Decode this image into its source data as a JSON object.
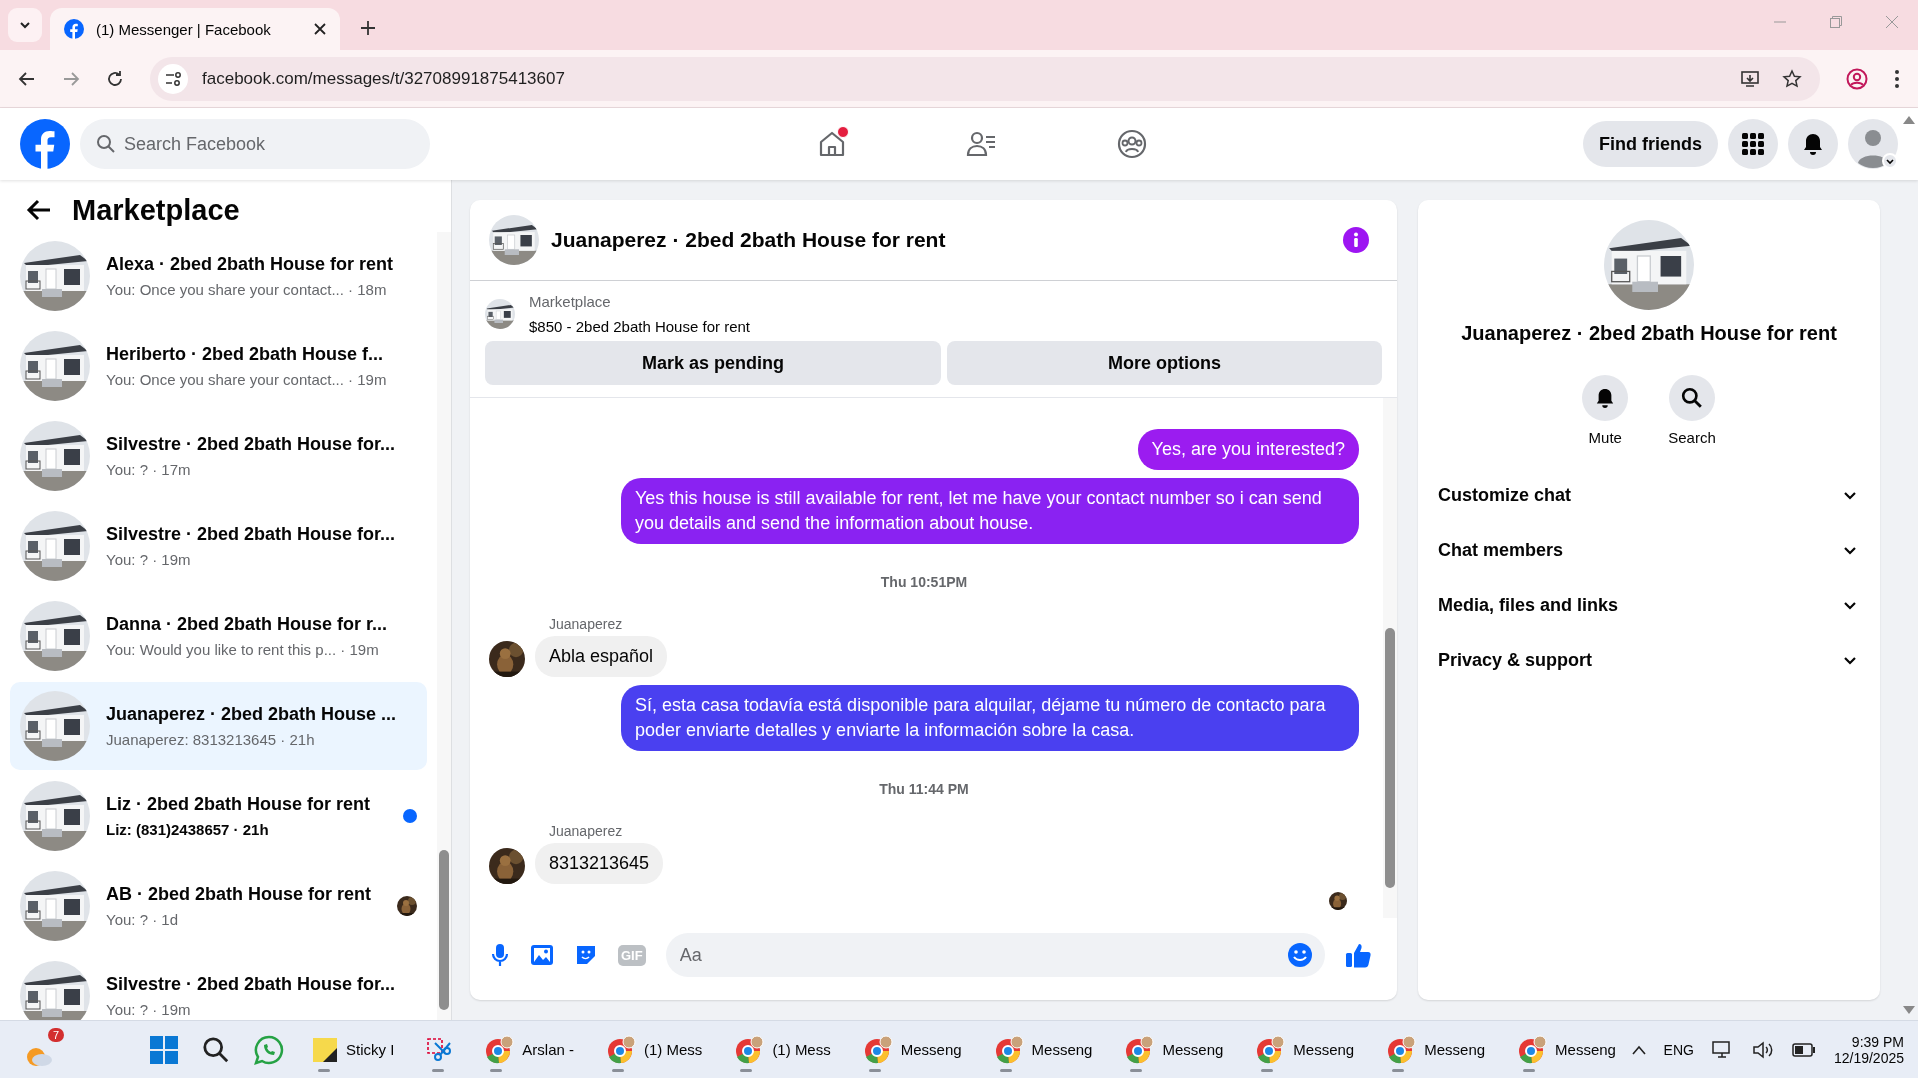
{
  "browser": {
    "tabs": [
      {
        "title": "(1) Messenger | Facebook",
        "selected": true
      }
    ],
    "url": "facebook.com/messages/t/32708991875413607"
  },
  "header": {
    "search_placeholder": "Search Facebook",
    "nav": [
      {
        "kind": "home",
        "selected": false,
        "notification": true
      },
      {
        "kind": "friends",
        "selected": false,
        "notification": false
      },
      {
        "kind": "groups",
        "selected": false,
        "notification": false
      }
    ],
    "find_friends": "Find friends"
  },
  "sidebar": {
    "title": "Marketplace",
    "conversations": [
      {
        "name": "Alexa · 2bed 2bath House for rent",
        "meta": "You: Once you share your contact... · 18m",
        "selected": false,
        "unread": false,
        "unread_dot": false,
        "seen_avatar": false
      },
      {
        "name": "Heriberto · 2bed 2bath House f...",
        "meta": "You: Once you share your contact... · 19m",
        "selected": false,
        "unread": false,
        "unread_dot": false,
        "seen_avatar": false
      },
      {
        "name": "Silvestre · 2bed 2bath House for...",
        "meta": "You: ? · 17m",
        "selected": false,
        "unread": false,
        "unread_dot": false,
        "seen_avatar": false
      },
      {
        "name": "Silvestre · 2bed 2bath House for...",
        "meta": "You: ? · 19m",
        "selected": false,
        "unread": false,
        "unread_dot": false,
        "seen_avatar": false
      },
      {
        "name": "Danna · 2bed 2bath House for r...",
        "meta": "You: Would you like to rent this p... · 19m",
        "selected": false,
        "unread": false,
        "unread_dot": false,
        "seen_avatar": false
      },
      {
        "name": "Juanaperez · 2bed 2bath House ...",
        "meta": "Juanaperez: 8313213645 · 21h",
        "selected": true,
        "unread": false,
        "unread_dot": false,
        "seen_avatar": false
      },
      {
        "name": "Liz · 2bed 2bath House for rent",
        "meta": "Liz: (831)2438657 · 21h",
        "selected": false,
        "unread": true,
        "unread_dot": true,
        "seen_avatar": false
      },
      {
        "name": "AB · 2bed 2bath House for rent",
        "meta": "You: ? · 1d",
        "selected": false,
        "unread": false,
        "unread_dot": false,
        "seen_avatar": true
      },
      {
        "name": "Silvestre · 2bed 2bath House for...",
        "meta": "You: ? · 19m",
        "selected": false,
        "unread": false,
        "unread_dot": false,
        "seen_avatar": false
      }
    ]
  },
  "chat": {
    "title": "Juanaperez · 2bed 2bath House for rent",
    "listing_label": "Marketplace",
    "listing": "$850 - 2bed 2bath House for rent",
    "buttons": [
      "Mark as pending",
      "More options"
    ],
    "messages": [
      {
        "kind": "out",
        "text": "Yes, are you interested?",
        "color": "#9b1cf0"
      },
      {
        "kind": "out",
        "text": "Yes this house is still available for rent, let me have your contact number so i can send you details and send the information about house.",
        "color": "#8a22f2"
      },
      {
        "kind": "time",
        "text": "Thu 10:51PM"
      },
      {
        "kind": "in",
        "sender": "Juanaperez",
        "text": "Abla español"
      },
      {
        "kind": "out",
        "text": "Sí, esta casa todavía está disponible para alquilar, déjame tu número de contacto para poder enviarte detalles y enviarte la información sobre la casa.",
        "color": "#4a40f0"
      },
      {
        "kind": "time",
        "text": "Thu 11:44 PM"
      },
      {
        "kind": "in",
        "sender": "Juanaperez",
        "text": "8313213645"
      }
    ],
    "gif_label": "GIF",
    "composer_placeholder": "Aa"
  },
  "info": {
    "title": "Juanaperez · 2bed 2bath House for rent",
    "actions": [
      {
        "kind": "mute",
        "label": "Mute"
      },
      {
        "kind": "search",
        "label": "Search"
      }
    ],
    "sections": [
      {
        "label": "Customize chat",
        "expanded": false
      },
      {
        "label": "Chat members",
        "expanded": false
      },
      {
        "label": "Media, files and links",
        "expanded": false
      },
      {
        "label": "Privacy & support",
        "expanded": false
      }
    ]
  },
  "taskbar": {
    "weather_badge": "7",
    "apps": [
      {
        "kind": "sticky",
        "label": "Sticky I"
      },
      {
        "kind": "snip"
      },
      {
        "kind": "chrome",
        "label": "Arslan -"
      },
      {
        "kind": "chrome",
        "label": "(1) Mess"
      },
      {
        "kind": "chrome",
        "label": "(1) Mess"
      },
      {
        "kind": "chrome",
        "label": "Messeng"
      },
      {
        "kind": "chrome",
        "label": "Messeng"
      },
      {
        "kind": "chrome",
        "label": "Messeng"
      },
      {
        "kind": "chrome",
        "label": "Messeng"
      },
      {
        "kind": "chrome",
        "label": "Messeng"
      },
      {
        "kind": "chrome",
        "label": "Messeng"
      }
    ],
    "language": "ENG",
    "time": "9:39 PM",
    "date": "12/19/2025"
  }
}
